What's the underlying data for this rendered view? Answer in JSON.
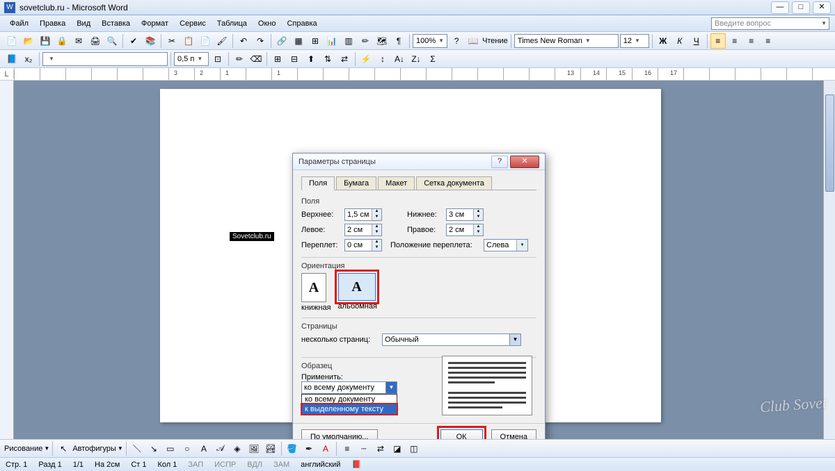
{
  "title": "sovetclub.ru - Microsoft Word",
  "menu": {
    "file": "Файл",
    "edit": "Правка",
    "view": "Вид",
    "insert": "Вставка",
    "format": "Формат",
    "tools": "Сервис",
    "table": "Таблица",
    "window": "Окно",
    "help": "Справка",
    "question_placeholder": "Введите вопрос"
  },
  "toolbar": {
    "zoom": "100%",
    "reading": "Чтение",
    "font": "Times New Roman",
    "size": "12",
    "spacing": "0,5 п",
    "bold": "Ж",
    "italic": "К",
    "underline": "Ч"
  },
  "document": {
    "selected_text": "Sovetclub.ru"
  },
  "dialog": {
    "title": "Параметры страницы",
    "tabs": {
      "fields": "Поля",
      "paper": "Бумага",
      "layout": "Макет",
      "grid": "Сетка документа"
    },
    "fields_section": {
      "label": "Поля",
      "top": "Верхнее:",
      "top_val": "1,5 см",
      "bottom": "Нижнее:",
      "bottom_val": "3 см",
      "left": "Левое:",
      "left_val": "2 см",
      "right": "Правое:",
      "right_val": "2 см",
      "gutter": "Переплет:",
      "gutter_val": "0 см",
      "gutter_pos": "Положение переплета:",
      "gutter_pos_val": "Слева"
    },
    "orientation": {
      "label": "Ориентация",
      "portrait": "книжная",
      "landscape": "альбомная"
    },
    "pages": {
      "label": "Страницы",
      "multi": "несколько страниц:",
      "multi_val": "Обычный"
    },
    "sample": {
      "label": "Образец",
      "apply": "Применить:",
      "opt1": "ко всему документу",
      "opt2": "ко всему документу",
      "opt3": "к выделенному тексту"
    },
    "buttons": {
      "default": "По умолчанию...",
      "ok": "ОК",
      "cancel": "Отмена"
    }
  },
  "drawing": {
    "label": "Рисование",
    "autoshapes": "Автофигуры"
  },
  "status": {
    "page": "Стр. 1",
    "section": "Разд 1",
    "pages": "1/1",
    "at": "На 2см",
    "line": "Ст 1",
    "col": "Кол 1",
    "rec": "ЗАП",
    "trk": "ИСПР",
    "ext": "ВДЛ",
    "ovr": "ЗАМ",
    "lang": "английский"
  },
  "watermark": "Club Sovet"
}
